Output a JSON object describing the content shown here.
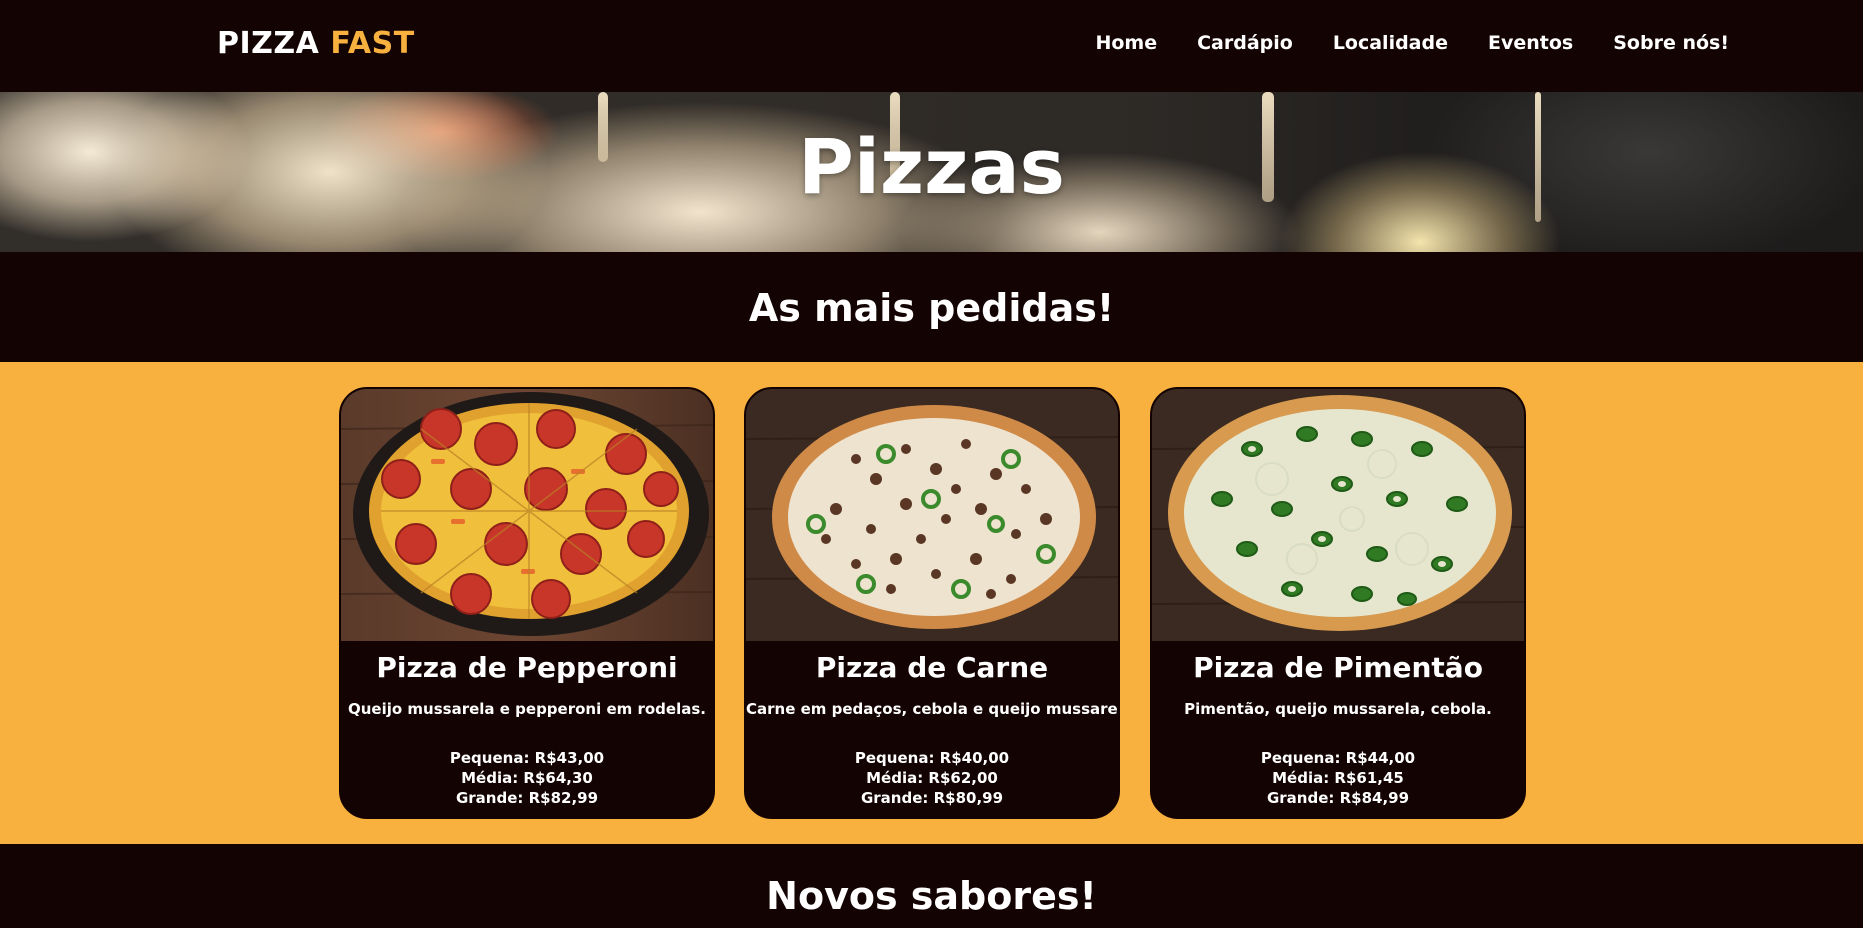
{
  "header": {
    "logo_main": "PIZZA",
    "logo_accent": "FAST",
    "nav": [
      "Home",
      "Cardápio",
      "Localidade",
      "Eventos",
      "Sobre nós!"
    ]
  },
  "hero": {
    "title": "Pizzas"
  },
  "sections": {
    "popular_title": "As mais pedidas!",
    "new_title": "Novos sabores!"
  },
  "cards": [
    {
      "title": "Pizza de Pepperoni",
      "description": "Queijo mussarela e pepperoni em rodelas.",
      "prices": [
        "Pequena: R$43,00",
        "Média: R$64,30",
        "Grande: R$82,99"
      ]
    },
    {
      "title": "Pizza de Carne",
      "description": "Carne em pedaços, cebola e queijo mussarela.",
      "prices": [
        "Pequena: R$40,00",
        "Média: R$62,00",
        "Grande: R$80,99"
      ]
    },
    {
      "title": "Pizza de Pimentão",
      "description": "Pimentão, queijo mussarela, cebola.",
      "prices": [
        "Pequena: R$44,00",
        "Média: R$61,45",
        "Grande: R$84,99"
      ]
    }
  ],
  "colors": {
    "dark": "#140303",
    "accent": "#f8b13f",
    "text": "#ffffff"
  }
}
